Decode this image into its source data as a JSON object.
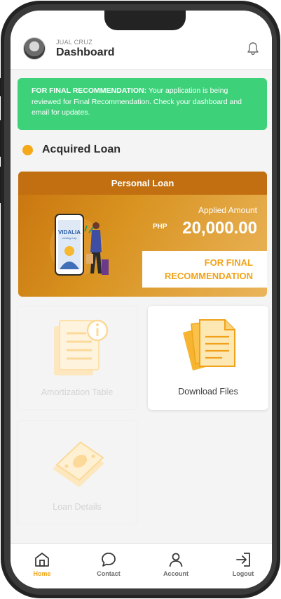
{
  "header": {
    "user_name": "JUAL CRUZ",
    "title": "Dashboard"
  },
  "alert": {
    "bold_text": "FOR FINAL RECOMMENDATION:",
    "text": " Your application is being reviewed for Final Recommendation. Check your dashboard and email for updates.",
    "color": "#3dd17a"
  },
  "section": {
    "title": "Acquired Loan",
    "dot_color": "#f5a818"
  },
  "loan": {
    "type": "Personal Loan",
    "applied_label": "Applied Amount",
    "currency": "PHP",
    "amount": "20,000.00",
    "status_line1": "FOR FINAL",
    "status_line2": "RECOMMENDATION",
    "logo_text": "VIDALIA",
    "logo_sub": "Lending Corp"
  },
  "tiles": [
    {
      "label": "Amortization Table",
      "icon": "document-info-icon",
      "enabled": false
    },
    {
      "label": "Download Files",
      "icon": "files-icon",
      "enabled": true
    },
    {
      "label": "Loan Details",
      "icon": "cash-icon",
      "enabled": false
    }
  ],
  "nav": [
    {
      "label": "Home",
      "icon": "home-icon",
      "active": true
    },
    {
      "label": "Contact",
      "icon": "chat-icon",
      "active": false
    },
    {
      "label": "Account",
      "icon": "user-icon",
      "active": false
    },
    {
      "label": "Logout",
      "icon": "logout-icon",
      "active": false
    }
  ],
  "colors": {
    "accent": "#f0a31a",
    "card_header": "#c26f11"
  }
}
